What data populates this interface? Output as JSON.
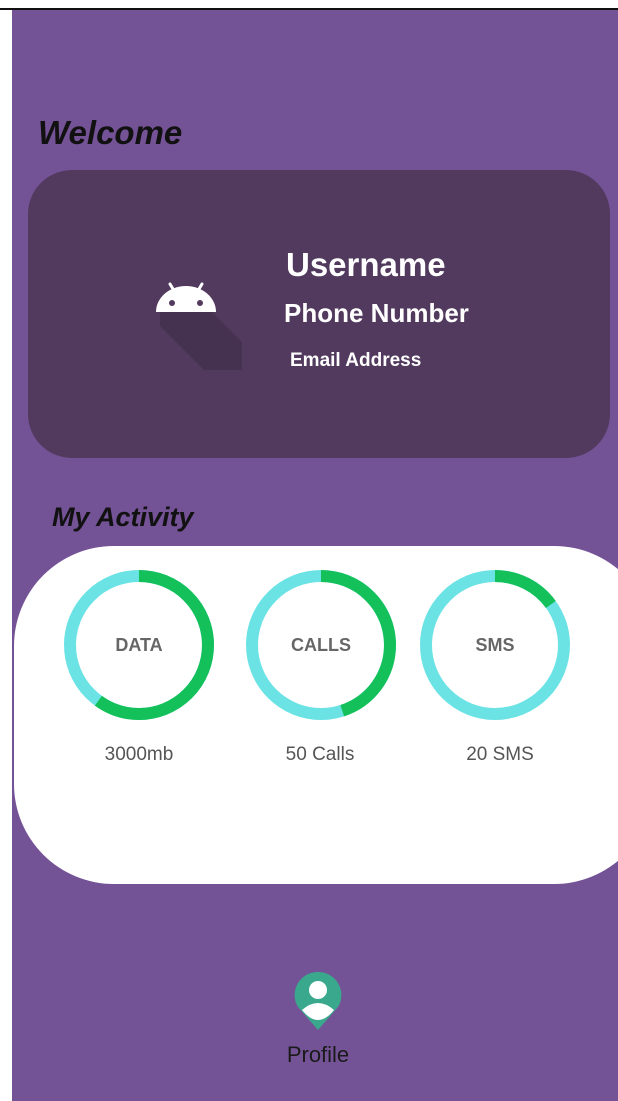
{
  "header": {
    "title": "Welcome"
  },
  "profile": {
    "username": "Username",
    "phone": "Phone Number",
    "email": "Email Address",
    "avatar_icon": "android-icon"
  },
  "activity": {
    "title": "My Activity",
    "items": [
      {
        "label": "DATA",
        "value": "3000mb",
        "progress": 0.6
      },
      {
        "label": "CALLS",
        "value": "50  Calls",
        "progress": 0.45
      },
      {
        "label": "SMS",
        "value": "20 SMS",
        "progress": 0.15
      }
    ],
    "colors": {
      "track": "#6be3e5",
      "fill": "#13c05a"
    }
  },
  "bottom_nav": {
    "profile_label": "Profile",
    "profile_icon": "person-pin-icon",
    "icon_color": "#3aa88d"
  }
}
